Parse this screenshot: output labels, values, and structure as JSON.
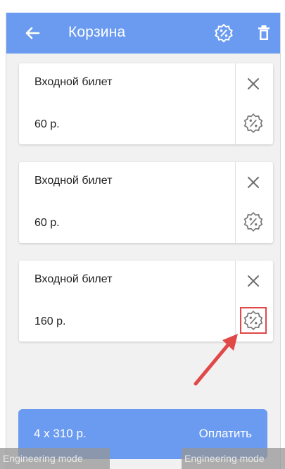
{
  "header": {
    "title": "Корзина",
    "back_icon": "arrow-left-icon",
    "discount_icon": "percent-badge-icon",
    "trash_icon": "trash-icon"
  },
  "cart": {
    "items": [
      {
        "name": "Входной билет",
        "price": "60 р."
      },
      {
        "name": "Входной билет",
        "price": "60 р."
      },
      {
        "name": "Входной билет",
        "price": "160 р."
      }
    ]
  },
  "footer": {
    "total": "4 x 310 р.",
    "pay_label": "Оплатить"
  },
  "overlay": {
    "engineering_mode": "Engineering mode"
  },
  "colors": {
    "accent": "#6b9bf0",
    "highlight": "#e14848"
  }
}
